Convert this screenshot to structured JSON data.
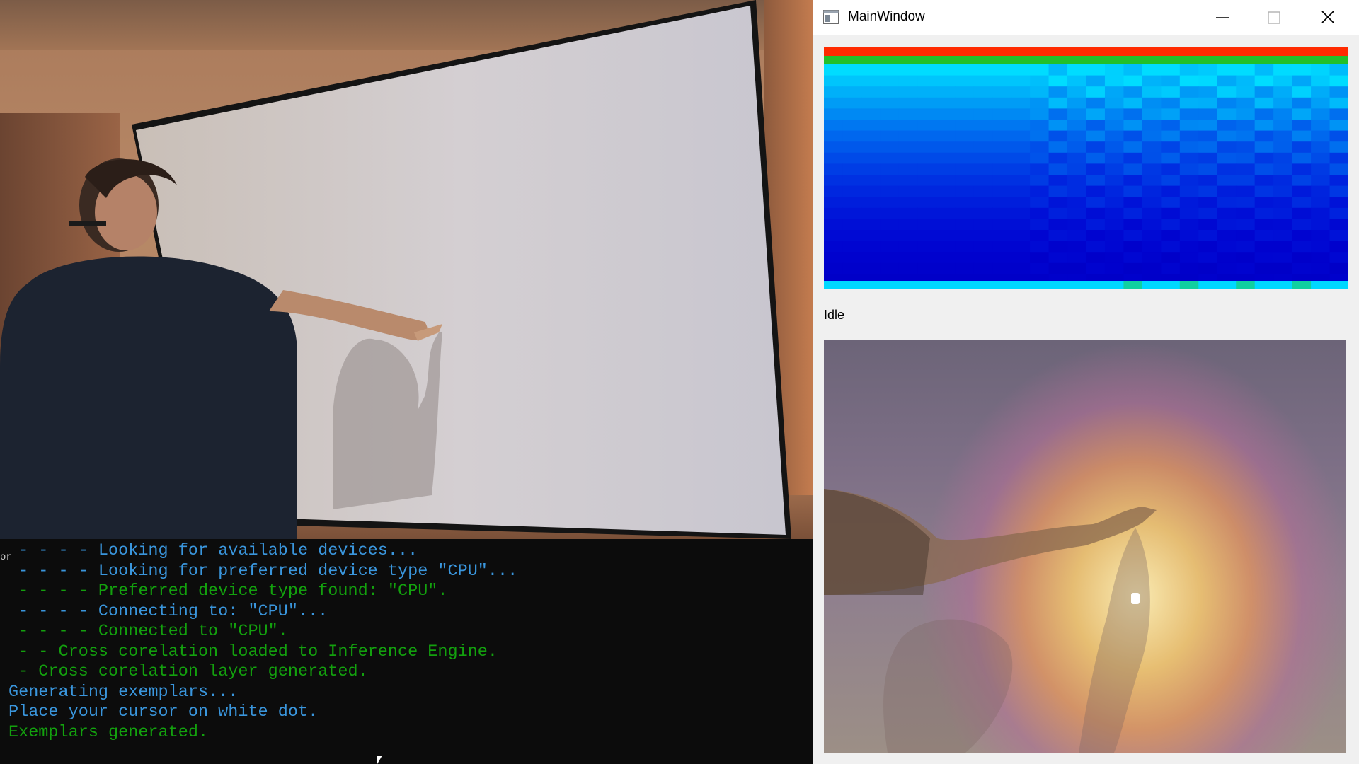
{
  "window": {
    "title": "MainWindow",
    "status": "Idle"
  },
  "console": {
    "gutter_char": "or",
    "lines": [
      {
        "text": " - - - - Looking for available devices...",
        "color": "#3a96dd"
      },
      {
        "text": " - - - - Looking for preferred device type \"CPU\"...",
        "color": "#3a96dd"
      },
      {
        "text": " - - - - Preferred device type found: \"CPU\".",
        "color": "#13a10e"
      },
      {
        "text": " - - - - Connecting to: \"CPU\"...",
        "color": "#3a96dd"
      },
      {
        "text": " - - - - Connected to \"CPU\".",
        "color": "#13a10e"
      },
      {
        "text": " - - Cross corelation loaded to Inference Engine.",
        "color": "#13a10e"
      },
      {
        "text": " - Cross corelation layer generated.",
        "color": "#13a10e"
      },
      {
        "text": "Generating exemplars...",
        "color": "#3a96dd"
      },
      {
        "text": "Place your cursor on white dot.",
        "color": "#3a96dd"
      },
      {
        "text": "Exemplars generated.",
        "color": "#13a10e"
      }
    ]
  },
  "icons": {
    "app": "window-app-icon",
    "minimize": "minimize-icon",
    "maximize": "maximize-icon",
    "close": "close-icon"
  },
  "colors": {
    "console_blue": "#3a96dd",
    "console_green": "#13a10e",
    "heatmap_top": "#ff2a00",
    "heatmap_cyan": "#00d8ff",
    "heatmap_deep": "#0000c8"
  }
}
